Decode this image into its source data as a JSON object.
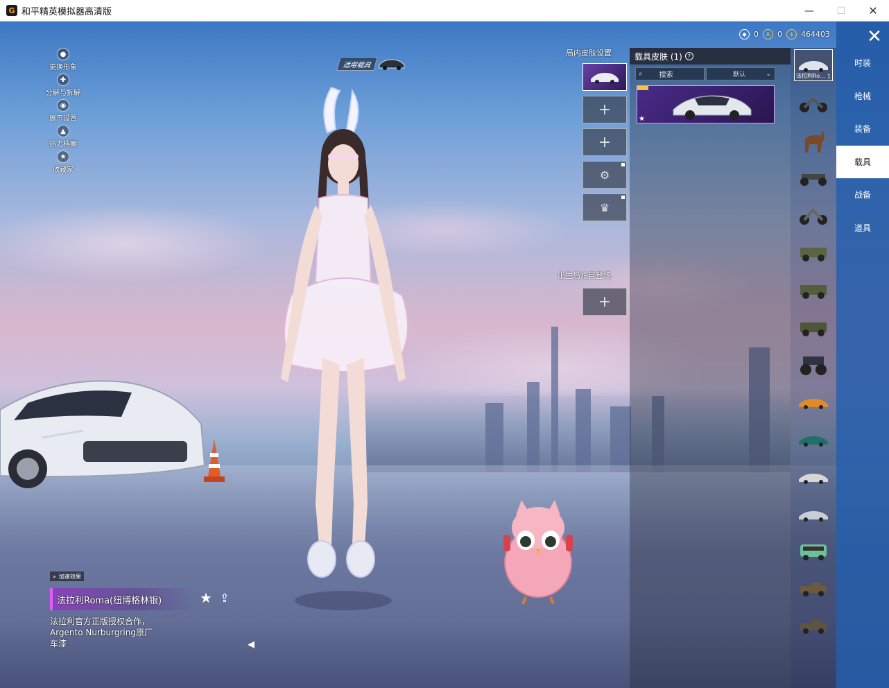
{
  "window": {
    "title": "和平精英模拟器高清版",
    "app_icon": "G",
    "minimize_glyph": "—",
    "maximize_glyph": "☐",
    "close_glyph": "✕"
  },
  "left_menu": {
    "items": [
      {
        "label": "更换形象",
        "icon": "person-icon",
        "glyph": "●"
      },
      {
        "label": "分解与拆解",
        "icon": "puzzle-icon",
        "glyph": "✚"
      },
      {
        "label": "展示设置",
        "icon": "eye-icon",
        "glyph": "◉"
      },
      {
        "label": "热力档案",
        "icon": "flame-icon",
        "glyph": "▲"
      },
      {
        "label": "收藏家",
        "icon": "badge-icon",
        "glyph": "★"
      }
    ]
  },
  "vehicle_tag": {
    "label": "适用载具"
  },
  "currencies": [
    {
      "icon": "token-icon",
      "glyph": "◆",
      "value": "0"
    },
    {
      "icon": "coupon-icon",
      "glyph": "A",
      "value": "0"
    },
    {
      "icon": "coin-icon",
      "glyph": "$",
      "value": "464403"
    }
  ],
  "slots": {
    "title": "局内皮肤设置",
    "plus": "+",
    "spawn_title": "出生岛炫目登场",
    "badge_glyph": "⚙",
    "crown_glyph": "♛"
  },
  "skins_panel": {
    "title": "载具皮肤 (1)",
    "help": "?",
    "search_placeholder": "搜索",
    "sort_label": "默认",
    "card_star": "★"
  },
  "vehicle_list": {
    "selected_label": "法拉利Ro...",
    "selected_count": "1"
  },
  "categories": [
    "时装",
    "枪械",
    "装备",
    "载具",
    "战备",
    "道具"
  ],
  "close_glyph": "✕",
  "bottom": {
    "boost_label": "加速效果",
    "vehicle_name": "法拉利Roma(纽博格林银)",
    "description": "法拉利官方正版授权合作，Argento Nurburgring原厂车漆",
    "star_glyph": "★",
    "share_glyph": "⇪",
    "horn_glyph": "◀"
  },
  "colors": {
    "tab_bar": "#235aa5",
    "selected_tab": "#ffffff",
    "legendary_purple": "#4a2a88"
  }
}
